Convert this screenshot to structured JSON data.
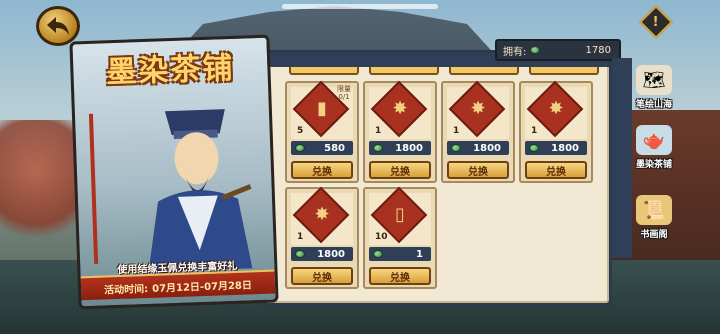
{
  "promo": {
    "title": "墨染茶铺",
    "slogan": "使用结缘玉佩兑换丰富好礼",
    "date_label": "活动时间:",
    "date_range": "07月12日-07月28日"
  },
  "owned": {
    "label": "拥有:",
    "value": "1780",
    "currency_icon": "jade-pendant-icon"
  },
  "items": [
    {
      "icon": "scroll-bundle-icon",
      "quantity": "5",
      "limit": "限量\n0/1",
      "price": "580",
      "button": "兑换"
    },
    {
      "icon": "fireworks-icon",
      "quantity": "1",
      "limit": "",
      "price": "1800",
      "button": "兑换"
    },
    {
      "icon": "fireworks-icon",
      "quantity": "1",
      "limit": "",
      "price": "1800",
      "button": "兑换"
    },
    {
      "icon": "fireworks-icon",
      "quantity": "1",
      "limit": "",
      "price": "1800",
      "button": "兑换"
    },
    {
      "icon": "fireworks-icon",
      "quantity": "1",
      "limit": "",
      "price": "1800",
      "button": "兑换"
    },
    {
      "icon": "bamboo-slip-icon",
      "quantity": "10",
      "limit": "",
      "price": "1",
      "button": "兑换"
    }
  ],
  "side_tabs": [
    {
      "label": "笔绘山海",
      "icon": "map-scroll-icon"
    },
    {
      "label": "墨染茶铺",
      "icon": "teapot-icon"
    },
    {
      "label": "书画阁",
      "icon": "book-pavilion-icon"
    }
  ],
  "colors": {
    "panel_bg": "#f1e9d4",
    "price_bar": "#2f3f58",
    "button_gold": "#e6b450",
    "title_gold": "#ffd36a"
  }
}
